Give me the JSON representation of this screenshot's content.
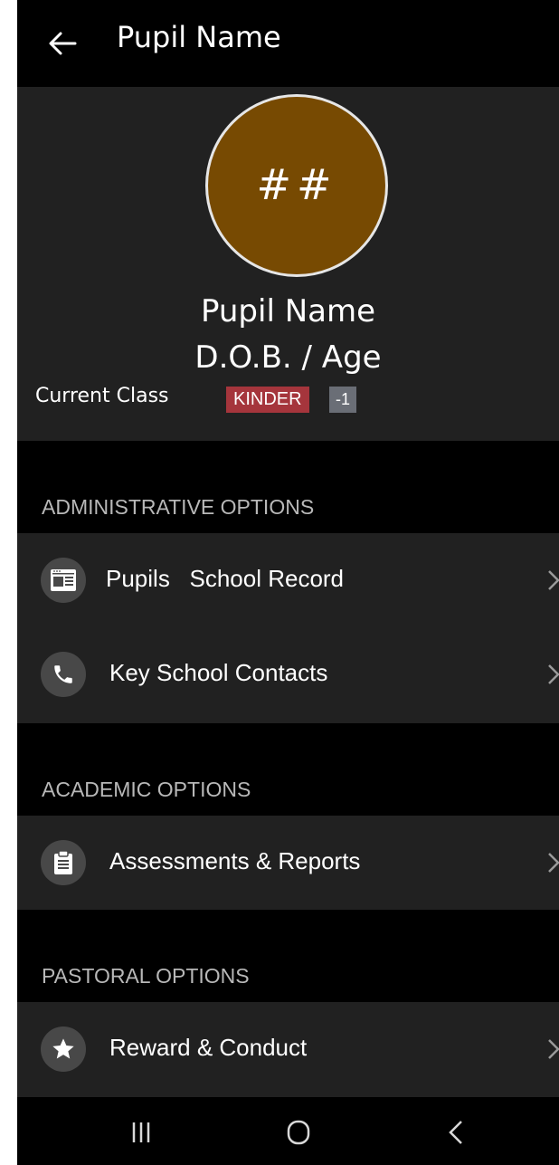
{
  "app_bar": {
    "title": "Pupil Name"
  },
  "profile": {
    "avatar_initials": "##",
    "name": "Pupil Name",
    "dob_age": "D.O.B. / Age",
    "class_label": "Current Class",
    "class_name": "KINDER",
    "class_number": "-1"
  },
  "sections": [
    {
      "title": "ADMINISTRATIVE OPTIONS",
      "items": [
        {
          "label": "Pupils   School Record",
          "icon": "record-icon"
        },
        {
          "label": "Key School Contacts",
          "icon": "phone-icon"
        }
      ]
    },
    {
      "title": "ACADEMIC OPTIONS",
      "items": [
        {
          "label": "Assessments & Reports",
          "icon": "clipboard-icon"
        }
      ]
    },
    {
      "title": "PASTORAL OPTIONS",
      "items": [
        {
          "label": "Reward & Conduct",
          "icon": "star-icon"
        }
      ]
    }
  ],
  "colors": {
    "avatar_bg": "#774a02",
    "class_badge": "#a5353c",
    "class_number_badge": "#6a6e76",
    "surface": "#212121",
    "background": "#000000"
  }
}
